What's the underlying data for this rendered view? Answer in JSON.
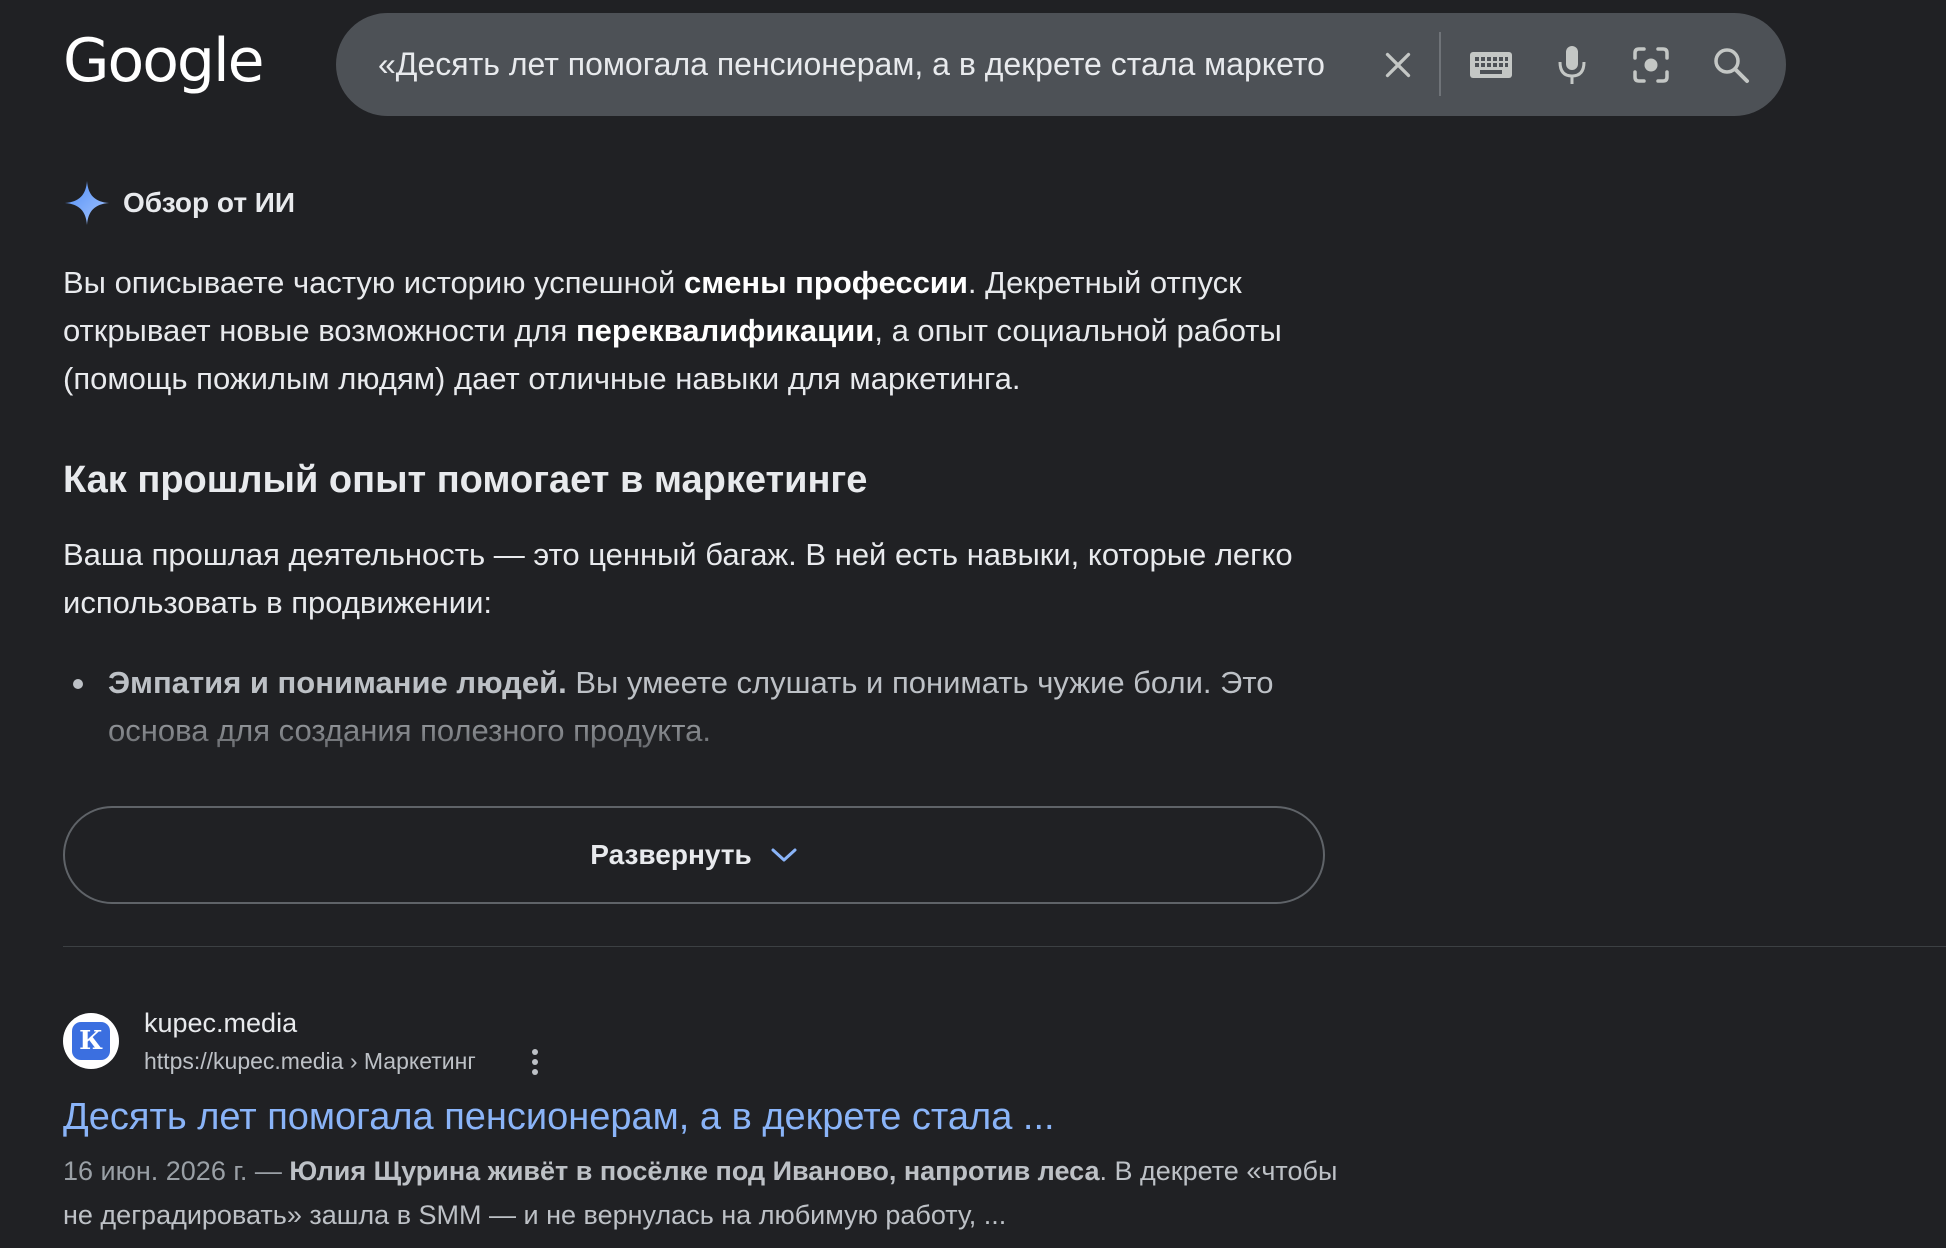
{
  "header": {
    "logo_text": "Google",
    "search_query": "«Десять лет помогала пенсионерам, а в декрете стала маркето"
  },
  "ai_overview": {
    "title": "Обзор от ИИ",
    "intro": {
      "t1": "Вы описываете частую историю успешной ",
      "b1": "смены профессии",
      "t2": ". Декретный отпуск открывает новые возможности для ",
      "b2": "переквалификации",
      "t3": ", а опыт социальной работы (помощь пожилым людям) дает отличные навыки для маркетинга."
    },
    "heading": "Как прошлый опыт помогает в маркетинге",
    "paragraph": "Ваша прошлая деятельность — это ценный багаж. В ней есть навыки, которые легко использовать в продвижении:",
    "bullets": [
      {
        "bold": "Эмпатия и понимание людей.",
        "text": " Вы умеете слушать и понимать чужие боли. Это основа для создания полезного продукта."
      }
    ],
    "expand_label": "Развернуть"
  },
  "result": {
    "favicon_letter": "К",
    "site_name": "kupec.media",
    "url": "https://kupec.media › Маркетинг",
    "title": "Десять лет помогала пенсионерам, а в декрете стала ...",
    "date": "16 июн. 2026 г. —",
    "snippet_bold": "Юлия Щурина живёт в посёлке под Иваново, напротив леса",
    "snippet_text": ". В декрете «чтобы не деградировать» зашла в SMM — и не вернулась на любимую работу, ..."
  },
  "colors": {
    "background": "#202124",
    "search_bar": "#4d5156",
    "link": "#8ab4f8",
    "spark": "#8ab4f8"
  },
  "icons": [
    "close-icon",
    "keyboard-icon",
    "mic-icon",
    "lens-icon",
    "search-icon",
    "sparkle-icon",
    "chevron-down-icon",
    "more-vert-icon"
  ]
}
